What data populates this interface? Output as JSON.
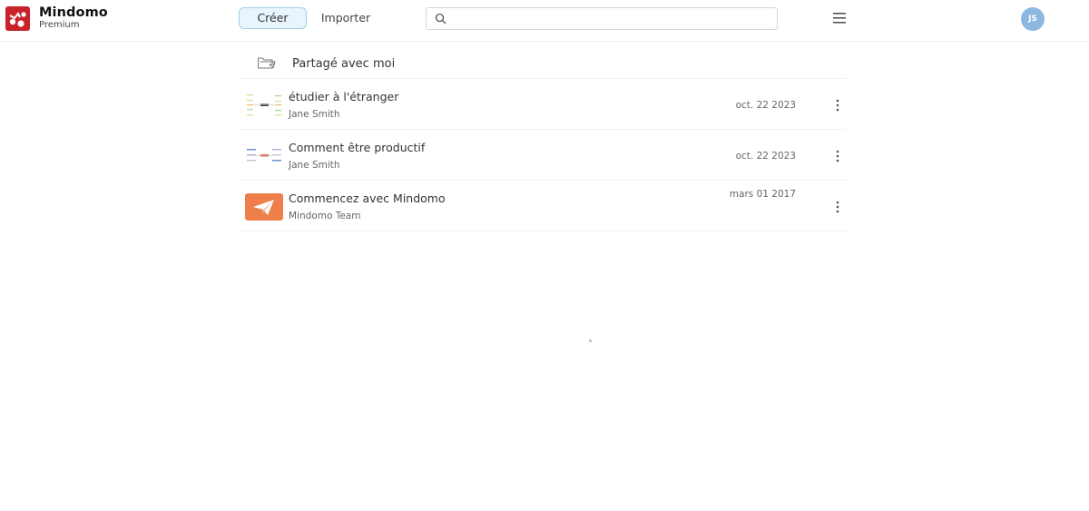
{
  "brand": {
    "name": "Mindomo",
    "plan": "Premium"
  },
  "header": {
    "create_label": "Créer",
    "import_label": "Importer",
    "search_value": "",
    "user_initials": "JS"
  },
  "shared": {
    "label": "Partagé avec moi"
  },
  "documents": [
    {
      "title": "étudier à l'étranger",
      "author": "Jane Smith",
      "date": "oct. 22 2023",
      "thumb": "mindmap-thumbnail-green"
    },
    {
      "title": "Comment être productif",
      "author": "Jane Smith",
      "date": "oct. 22 2023",
      "thumb": "mindmap-thumbnail-blue"
    },
    {
      "title": "Commencez avec Mindomo",
      "author": "Mindomo Team",
      "date": "mars 01 2017",
      "thumb": "paper-plane-icon"
    }
  ],
  "colors": {
    "brand_red": "#c8232c",
    "accent_blue": "#9fd1ea",
    "avatar": "#8cb8e0",
    "plane_orange": "#ee7f4a"
  }
}
